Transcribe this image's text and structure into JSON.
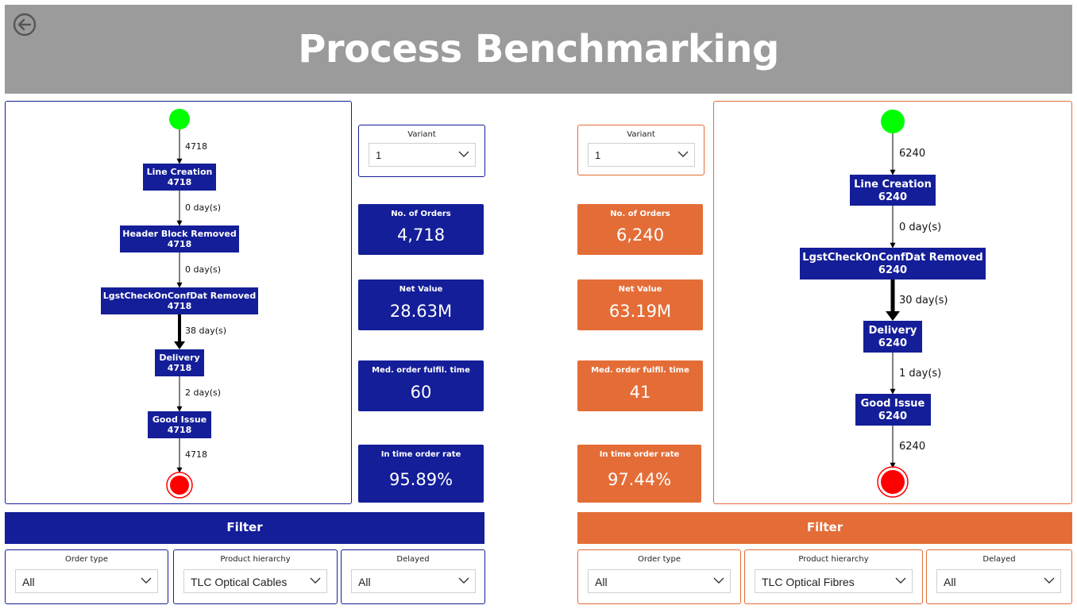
{
  "header": {
    "title": "Process Benchmarking",
    "back_icon": "back-arrow-icon"
  },
  "colors": {
    "left": "#141e98",
    "right": "#e46d37",
    "header": "#9b9b9b",
    "start": "#00ff00",
    "end": "#ff0000"
  },
  "left": {
    "flow": {
      "start_count": "4718",
      "nodes": [
        {
          "name": "Line Creation",
          "count": "4718"
        },
        {
          "name": "Header Block Removed",
          "count": "4718"
        },
        {
          "name": "LgstCheckOnConfDat Removed",
          "count": "4718"
        },
        {
          "name": "Delivery",
          "count": "4718"
        },
        {
          "name": "Good Issue",
          "count": "4718"
        }
      ],
      "edges": [
        "0 day(s)",
        "0 day(s)",
        "38 day(s)",
        "2 day(s)"
      ],
      "end_count": "4718"
    },
    "variant": {
      "label": "Variant",
      "value": "1"
    },
    "kpis": [
      {
        "title": "No. of Orders",
        "value": "4,718"
      },
      {
        "title": "Net Value",
        "value": "28.63M"
      },
      {
        "title": "Med. order fulfil. time",
        "value": "60"
      },
      {
        "title": "In time order rate",
        "value": "95.89%"
      }
    ],
    "filter_title": "Filter",
    "slicers": [
      {
        "label": "Order type",
        "value": "All"
      },
      {
        "label": "Product hierarchy",
        "value": "TLC Optical Cables"
      },
      {
        "label": "Delayed",
        "value": "All"
      }
    ]
  },
  "right": {
    "flow": {
      "start_count": "6240",
      "nodes": [
        {
          "name": "Line Creation",
          "count": "6240"
        },
        {
          "name": "LgstCheckOnConfDat Removed",
          "count": "6240"
        },
        {
          "name": "Delivery",
          "count": "6240"
        },
        {
          "name": "Good Issue",
          "count": "6240"
        }
      ],
      "edges": [
        "0 day(s)",
        "30 day(s)",
        "1 day(s)"
      ],
      "end_count": "6240"
    },
    "variant": {
      "label": "Variant",
      "value": "1"
    },
    "kpis": [
      {
        "title": "No. of Orders",
        "value": "6,240"
      },
      {
        "title": "Net Value",
        "value": "63.19M"
      },
      {
        "title": "Med. order fulfil. time",
        "value": "41"
      },
      {
        "title": "In time order rate",
        "value": "97.44%"
      }
    ],
    "filter_title": "Filter",
    "slicers": [
      {
        "label": "Order type",
        "value": "All"
      },
      {
        "label": "Product hierarchy",
        "value": "TLC Optical Fibres"
      },
      {
        "label": "Delayed",
        "value": "All"
      }
    ]
  }
}
